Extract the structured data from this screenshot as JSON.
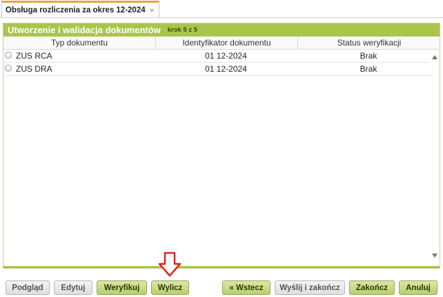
{
  "tab": {
    "label": "Obsługa rozliczenia za okres 12-2024",
    "close_glyph": "×"
  },
  "panel": {
    "title": "Utworzenie i walidacja dokumentów",
    "step": "krok 5 z 5"
  },
  "table": {
    "columns": [
      "Typ dokumentu",
      "Identyfikator dokumentu",
      "Status weryfikacji"
    ],
    "rows": [
      {
        "type": "ZUS RCA",
        "id": "01 12-2024",
        "status": "Brak"
      },
      {
        "type": "ZUS DRA",
        "id": "01 12-2024",
        "status": "Brak"
      }
    ]
  },
  "buttons": {
    "preview": "Podgląd",
    "edit": "Edytuj",
    "verify": "Weryfikuj",
    "calculate": "Wylicz",
    "back": "« Wstecz",
    "send_finish": "Wyślij i zakończ",
    "finish": "Zakończ",
    "cancel": "Anuluj"
  },
  "colors": {
    "header_green": "#a9c64b",
    "tab_accent": "#e8a24a",
    "annotation_arrow": "#e02020"
  }
}
